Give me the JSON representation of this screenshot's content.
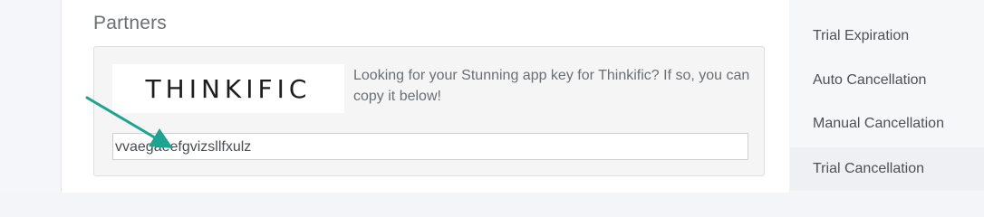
{
  "main": {
    "section_title": "Partners",
    "partner": {
      "logo_text": "THINKIFIC",
      "description": "Looking for your Stunning app key for Thinkific? If so, you can copy it below!",
      "app_key_value": "vvaegaeefgvizsllfxulz"
    },
    "annotation": {
      "arrow_color": "#1ea38f"
    }
  },
  "sidebar": {
    "items": [
      {
        "label": "Trial Expiration"
      },
      {
        "label": "Auto Cancellation"
      },
      {
        "label": "Manual Cancellation"
      },
      {
        "label": "Trial Cancellation"
      }
    ]
  }
}
